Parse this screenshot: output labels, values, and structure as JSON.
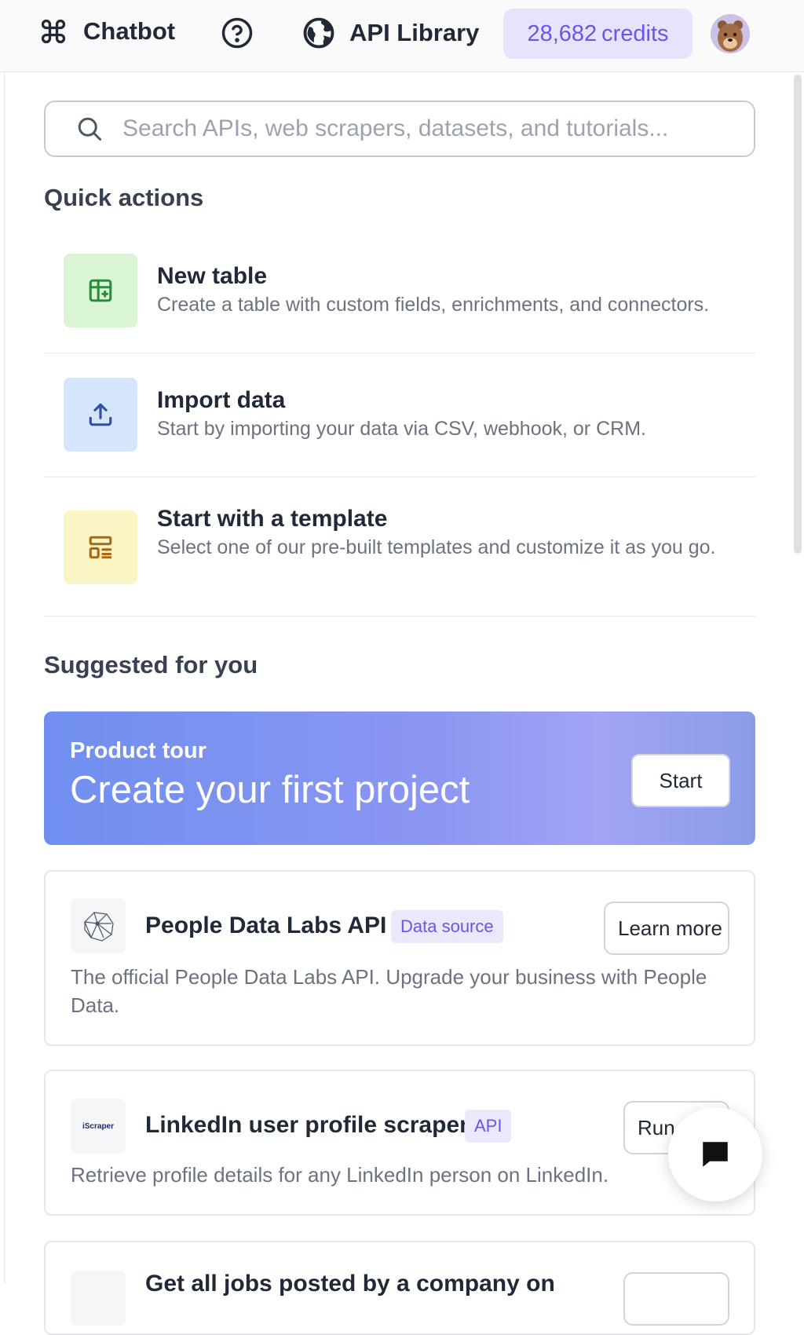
{
  "topbar": {
    "chatbot_label": "Chatbot",
    "api_library_label": "API Library",
    "credits_value": "28,682",
    "credits_unit": "credits"
  },
  "search": {
    "placeholder": "Search APIs, web scrapers, datasets, and tutorials..."
  },
  "quick_actions": {
    "heading": "Quick actions",
    "items": [
      {
        "title": "New table",
        "description": "Create a table with custom fields, enrichments, and connectors.",
        "icon": "table-add-icon",
        "color": "#d9f5d3"
      },
      {
        "title": "Import data",
        "description": "Start by importing your data via CSV, webhook, or CRM.",
        "icon": "upload-icon",
        "color": "#d5e5fb"
      },
      {
        "title": "Start with a template",
        "description": "Select one of our pre-built templates and customize it as you go.",
        "icon": "template-icon",
        "color": "#fbf4c4"
      }
    ]
  },
  "suggested": {
    "heading": "Suggested for you",
    "tour": {
      "eyebrow": "Product tour",
      "title": "Create your first project",
      "button": "Start"
    },
    "cards": [
      {
        "title": "People Data Labs API",
        "badge": "Data source",
        "description": "The official People Data Labs API. Upgrade your business with People Data.",
        "button": "Learn more",
        "logo": "people-data-labs-logo"
      },
      {
        "title": "LinkedIn user profile scraper",
        "badge": "API",
        "description": "Retrieve profile details for any LinkedIn person on LinkedIn.",
        "button": "Run",
        "logo": "iscraper-logo",
        "logo_text": "iScraper"
      },
      {
        "title": "Get all jobs posted by a company on"
      }
    ]
  },
  "colors": {
    "accent": "#6d54e8",
    "credits_bg": "#e6e4fc"
  }
}
